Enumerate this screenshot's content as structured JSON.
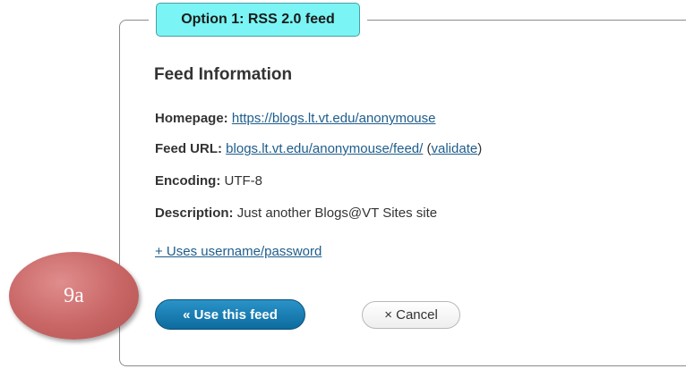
{
  "option_legend": "Option 1: RSS 2.0 feed",
  "section_title": "Feed Information",
  "homepage": {
    "label": "Homepage:",
    "url": "https://blogs.lt.vt.edu/anonymouse"
  },
  "feed_url": {
    "label": "Feed URL:",
    "url": "blogs.lt.vt.edu/anonymouse/feed/",
    "open_paren": "(",
    "validate_link": "validate",
    "close_paren": ")"
  },
  "encoding": {
    "label": "Encoding:",
    "value": "UTF-8"
  },
  "description": {
    "label": "Description:",
    "value": "Just another Blogs@VT Sites site"
  },
  "auth_toggle": "+ Uses username/password",
  "buttons": {
    "use_feed": "« Use this feed",
    "cancel": "× Cancel"
  },
  "annotation_label": "9a",
  "colors": {
    "legend_bg": "#7af4f4",
    "link": "#1e5d8c",
    "primary_button": "#1a7fb5",
    "annotation": "#c86565"
  }
}
